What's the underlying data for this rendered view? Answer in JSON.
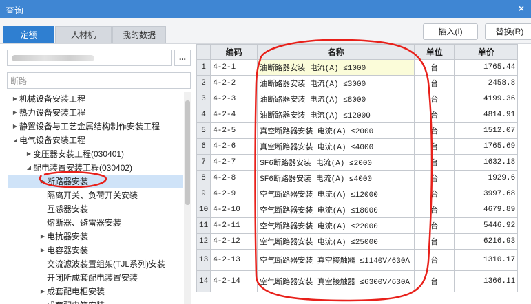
{
  "window": {
    "title": "查询",
    "close_glyph": "×"
  },
  "tabs": [
    "定额",
    "人材机",
    "我的数据"
  ],
  "buttons": {
    "insert": "插入(I)",
    "replace": "替换(R)"
  },
  "left_panel": {
    "more_button": "...",
    "search_value": "断路"
  },
  "tree": [
    {
      "label": "机械设备安装工程",
      "level": 0,
      "arrow": "right",
      "selected": false
    },
    {
      "label": "热力设备安装工程",
      "level": 0,
      "arrow": "right",
      "selected": false
    },
    {
      "label": "静置设备与工艺金属结构制作安装工程",
      "level": 0,
      "arrow": "right",
      "selected": false
    },
    {
      "label": "电气设备安装工程",
      "level": 0,
      "arrow": "down",
      "selected": false
    },
    {
      "label": "变压器安装工程(030401)",
      "level": 1,
      "arrow": "right",
      "selected": false
    },
    {
      "label": "配电装置安装工程(030402)",
      "level": 1,
      "arrow": "down",
      "selected": false
    },
    {
      "label": "断路器安装",
      "level": 2,
      "arrow": "right",
      "selected": true
    },
    {
      "label": "隔离开关、负荷开关安装",
      "level": 2,
      "arrow": "none",
      "selected": false
    },
    {
      "label": "互感器安装",
      "level": 2,
      "arrow": "none",
      "selected": false
    },
    {
      "label": "熔断器、避雷器安装",
      "level": 2,
      "arrow": "none",
      "selected": false
    },
    {
      "label": "电抗器安装",
      "level": 2,
      "arrow": "right",
      "selected": false
    },
    {
      "label": "电容器安装",
      "level": 2,
      "arrow": "right",
      "selected": false
    },
    {
      "label": "交流滤波装置组架(TJL系列)安装",
      "level": 2,
      "arrow": "none",
      "selected": false
    },
    {
      "label": "开闭所成套配电装置安装",
      "level": 2,
      "arrow": "none",
      "selected": false
    },
    {
      "label": "成套配电柜安装",
      "level": 2,
      "arrow": "right",
      "selected": false
    },
    {
      "label": "成套配电箱安装",
      "level": 2,
      "arrow": "none",
      "selected": false
    }
  ],
  "table": {
    "headers": [
      "",
      "编码",
      "名称",
      "单位",
      "单价"
    ],
    "rows": [
      {
        "n": "1",
        "code": "4-2-1",
        "name": "油断路器安装 电流(A) ≤1000",
        "unit": "台",
        "price": "1765.44"
      },
      {
        "n": "2",
        "code": "4-2-2",
        "name": "油断路器安装 电流(A) ≤3000",
        "unit": "台",
        "price": "2458.8"
      },
      {
        "n": "3",
        "code": "4-2-3",
        "name": "油断路器安装 电流(A) ≤8000",
        "unit": "台",
        "price": "4199.36"
      },
      {
        "n": "4",
        "code": "4-2-4",
        "name": "油断路器安装 电流(A) ≤12000",
        "unit": "台",
        "price": "4814.91"
      },
      {
        "n": "5",
        "code": "4-2-5",
        "name": "真空断路器安装 电流(A) ≤2000",
        "unit": "台",
        "price": "1512.07"
      },
      {
        "n": "6",
        "code": "4-2-6",
        "name": "真空断路器安装 电流(A) ≤4000",
        "unit": "台",
        "price": "1765.69"
      },
      {
        "n": "7",
        "code": "4-2-7",
        "name": "SF6断路器安装 电流(A) ≤2000",
        "unit": "台",
        "price": "1632.18"
      },
      {
        "n": "8",
        "code": "4-2-8",
        "name": "SF6断路器安装 电流(A) ≤4000",
        "unit": "台",
        "price": "1929.6"
      },
      {
        "n": "9",
        "code": "4-2-9",
        "name": "空气断路器安装 电流(A) ≤12000",
        "unit": "台",
        "price": "3997.68"
      },
      {
        "n": "10",
        "code": "4-2-10",
        "name": "空气断路器安装 电流(A) ≤18000",
        "unit": "台",
        "price": "4679.89"
      },
      {
        "n": "11",
        "code": "4-2-11",
        "name": "空气断路器安装 电流(A) ≤22000",
        "unit": "台",
        "price": "5446.92"
      },
      {
        "n": "12",
        "code": "4-2-12",
        "name": "空气断路器安装 电流(A) ≤25000",
        "unit": "台",
        "price": "6216.93"
      },
      {
        "n": "13",
        "code": "4-2-13",
        "name": "空气断路器安装 真空接触器 ≤1140V/630A",
        "unit": "台",
        "price": "1310.17"
      },
      {
        "n": "14",
        "code": "4-2-14",
        "name": "空气断路器安装 真空接触器 ≤6300V/630A",
        "unit": "台",
        "price": "1366.11"
      }
    ]
  },
  "colors": {
    "titlebar": "#3f86d3",
    "tab_active": "#2f7fd1",
    "annotation": "#e8201a",
    "selection": "#cfe3f8"
  }
}
